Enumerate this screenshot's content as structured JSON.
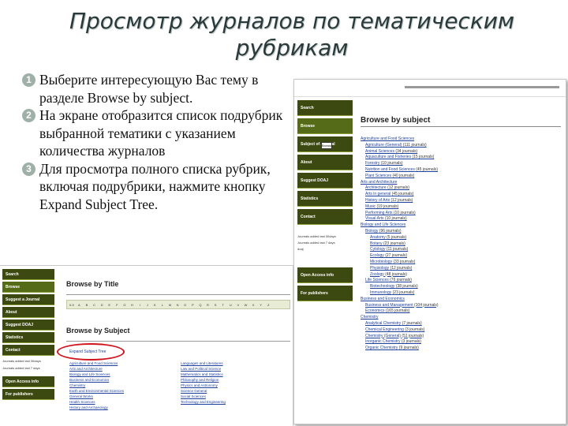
{
  "slide": {
    "title": "Просмотр журналов по тематическим рубрикам",
    "steps": [
      {
        "num": "1",
        "text": "Выберите интересующую Вас тему в разделе Browse by subject."
      },
      {
        "num": "2",
        "text": "На экране отобразится список подрубрик выбранной тематики с указанием количества журналов"
      },
      {
        "num": "3",
        "text": "Для просмотра полного списка рубрик, включая подрубрики, нажмите кнопку Expand Subject Tree."
      }
    ]
  },
  "right_screenshot": {
    "sidebar_buttons": [
      "Search",
      "Browse",
      "Subject of Journal",
      "About",
      "Suggest DOAJ",
      "Statistics",
      "Contact"
    ],
    "tooltip": "Browse",
    "sidebar_links": [
      "Journals added last 30days",
      "Journals added last 7 days",
      "doaj"
    ],
    "sidebar_buttons_bottom": [
      "Open Access info",
      "For publishers"
    ],
    "heading": "Browse by subject",
    "tree": [
      {
        "level": 0,
        "label": "Agriculture and Food Sciences",
        "count": ""
      },
      {
        "level": 1,
        "label": "Agriculture (General)",
        "count": "(111 journals)"
      },
      {
        "level": 1,
        "label": "Animal Sciences",
        "count": "(34 journals)"
      },
      {
        "level": 1,
        "label": "Aquaculture and Fisheries",
        "count": "(15 journals)"
      },
      {
        "level": 1,
        "label": "Forestry",
        "count": "(10 journals)"
      },
      {
        "level": 1,
        "label": "Nutrition and Food Sciences",
        "count": "(45 journals)"
      },
      {
        "level": 1,
        "label": "Plant Sciences",
        "count": "(40 journals)"
      },
      {
        "level": 0,
        "label": "Arts and Architecture",
        "count": ""
      },
      {
        "level": 1,
        "label": "Architecture",
        "count": "(12 journals)"
      },
      {
        "level": 1,
        "label": "Arts in general",
        "count": "(45 journals)"
      },
      {
        "level": 1,
        "label": "History of Arts",
        "count": "(12 journals)"
      },
      {
        "level": 1,
        "label": "Music",
        "count": "(19 journals)"
      },
      {
        "level": 1,
        "label": "Performing Arts",
        "count": "(10 journals)"
      },
      {
        "level": 1,
        "label": "Visual Arts",
        "count": "(10 journals)"
      },
      {
        "level": 0,
        "label": "Biology and Life Sciences",
        "count": ""
      },
      {
        "level": 1,
        "label": "Biology",
        "count": "(96 journals)"
      },
      {
        "level": 2,
        "label": "Anatomy",
        "count": "(5 journals)"
      },
      {
        "level": 2,
        "label": "Botany",
        "count": "(23 journals)"
      },
      {
        "level": 2,
        "label": "Cytology",
        "count": "(11 journals)"
      },
      {
        "level": 2,
        "label": "Ecology",
        "count": "(27 journals)"
      },
      {
        "level": 2,
        "label": "Microbiology",
        "count": "(33 journals)"
      },
      {
        "level": 2,
        "label": "Physiology",
        "count": "(12 journals)"
      },
      {
        "level": 2,
        "label": "Zoology",
        "count": "(48 journals)"
      },
      {
        "level": 1,
        "label": "Life Sciences",
        "count": "(76 journals)"
      },
      {
        "level": 2,
        "label": "Biotechnology",
        "count": "(38 journals)"
      },
      {
        "level": 2,
        "label": "Immunology",
        "count": "(23 journals)"
      },
      {
        "level": 0,
        "label": "Business and Economics",
        "count": ""
      },
      {
        "level": 1,
        "label": "Business and Management",
        "count": "(104 journals)"
      },
      {
        "level": 1,
        "label": "Economics",
        "count": "(165 journals)"
      },
      {
        "level": 0,
        "label": "Chemistry",
        "count": ""
      },
      {
        "level": 1,
        "label": "Analytical Chemistry",
        "count": "(7 journals)"
      },
      {
        "level": 1,
        "label": "Chemical Engineering",
        "count": "(3 journals)"
      },
      {
        "level": 1,
        "label": "Chemistry (General)",
        "count": "(51 journals)"
      },
      {
        "level": 1,
        "label": "Inorganic Chemistry",
        "count": "(3 journals)"
      },
      {
        "level": 1,
        "label": "Organic Chemistry",
        "count": "(9 journals)"
      }
    ]
  },
  "bottom_screenshot": {
    "sidebar_buttons": [
      "Search",
      "Browse",
      "Suggest a Journal",
      "About",
      "Suggest DOAJ",
      "Statistics",
      "Contact"
    ],
    "sidebar_links": [
      "Journals added last 30days",
      "Journals added last 7 days"
    ],
    "sidebar_buttons_bottom": [
      "Open Access info",
      "For publishers"
    ],
    "browse_title_heading": "Browse by Title",
    "alphabet": [
      "0-9",
      "A",
      "B",
      "C",
      "D",
      "E",
      "F",
      "G",
      "H",
      "I",
      "J",
      "K",
      "L",
      "M",
      "N",
      "O",
      "P",
      "Q",
      "R",
      "S",
      "T",
      "U",
      "V",
      "W",
      "X",
      "Y",
      "Z"
    ],
    "browse_subject_heading": "Browse by Subject",
    "expand_link": "Expand Subject Tree",
    "col1": [
      "Agriculture and Food Sciences",
      "Arts and Architecture",
      "Biology and Life Sciences",
      "Business and Economics",
      "Chemistry",
      "Earth and Environmental Sciences",
      "General Works",
      "Health Sciences",
      "History and Archaeology"
    ],
    "col2": [
      "Languages and Literatures",
      "Law and Political Science",
      "Mathematics and Statistics",
      "Philosophy and Religion",
      "Physics and Astronomy",
      "Science General",
      "Social Sciences",
      "Technology and Engineering"
    ]
  }
}
